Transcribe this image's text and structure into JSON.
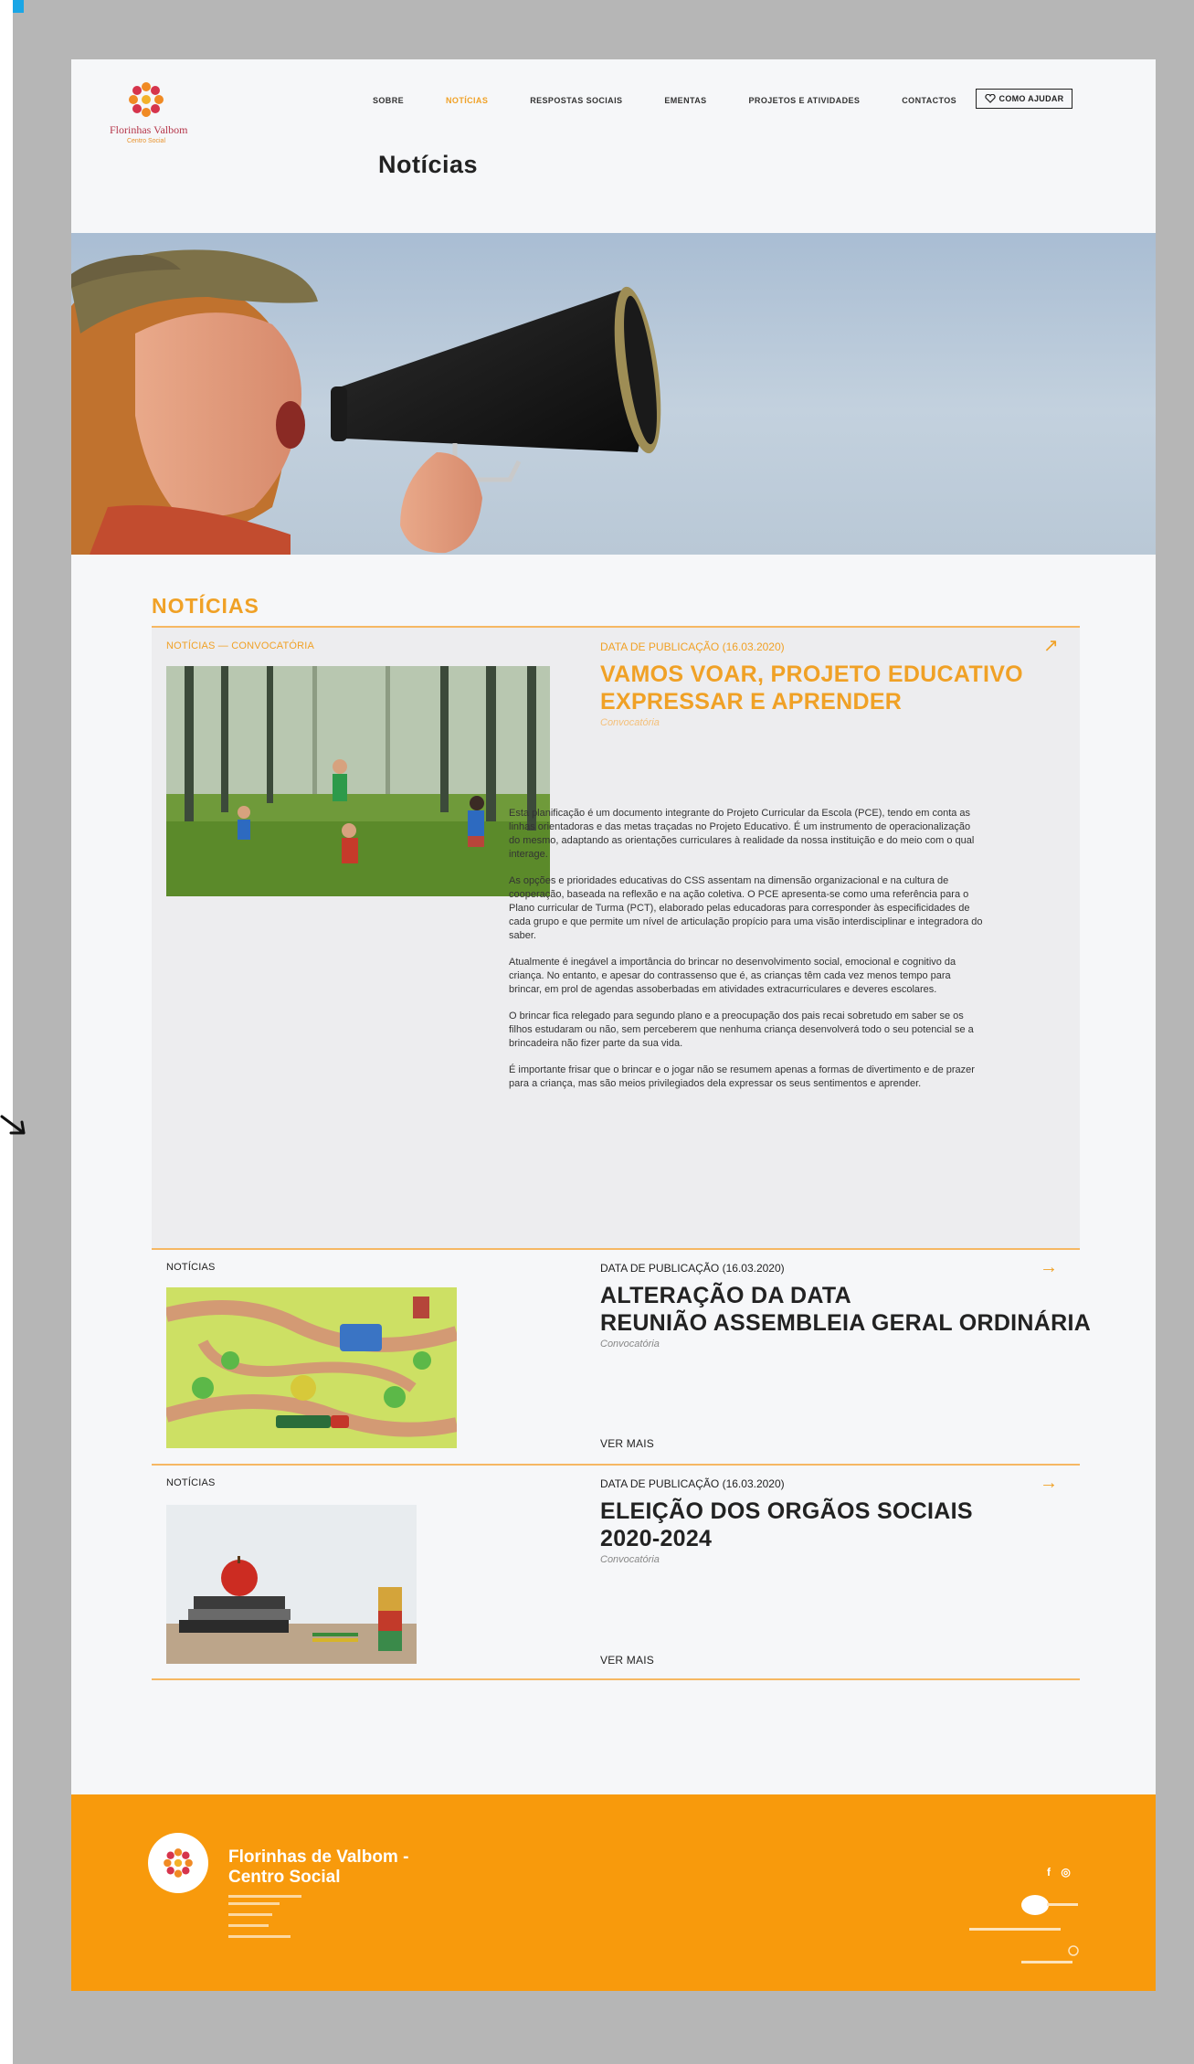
{
  "header": {
    "logo": {
      "name": "Florinhas Valbom",
      "subtitle": "Centro Social"
    },
    "nav": [
      {
        "label": "SOBRE",
        "active": false
      },
      {
        "label": "NOTÍCIAS",
        "active": true
      },
      {
        "label": "RESPOSTAS SOCIAIS",
        "active": false
      },
      {
        "label": "EMENTAS",
        "active": false
      },
      {
        "label": "PROJETOS E ATIVIDADES",
        "active": false
      },
      {
        "label": "CONTACTOS",
        "active": false
      }
    ],
    "help_button": "COMO AJUDAR",
    "page_title": "Notícias"
  },
  "news": {
    "section_title": "NOTÍCIAS",
    "featured": {
      "category": "NOTÍCIAS — CONVOCATÓRIA",
      "date": "DATA DE PUBLICAÇÃO (16.03.2020)",
      "title_line1": "VAMOS VOAR, PROJETO EDUCATIVO",
      "title_line2": "EXPRESSAR E APRENDER",
      "subcategory": "Convocatória",
      "paragraphs": [
        "Esta planificação é um documento integrante do Projeto Curricular da Escola (PCE), tendo em conta as linhas orientadoras e das metas traçadas no Projeto Educativo. É um instrumento de operacionalização do mesmo, adaptando as orientações curriculares à realidade da nossa instituição e do meio com o qual interage.",
        "As opções e prioridades educativas do CSS assentam na dimensão organizacional e na cultura de cooperação, baseada na reflexão e na ação coletiva. O PCE apresenta-se como uma referência para o Plano curricular de Turma (PCT), elaborado pelas educadoras para corresponder às especificidades de cada grupo e que permite um nível de articulação propício para uma visão interdisciplinar e integradora do saber.",
        "Atualmente é inegável a importância do brincar no desenvolvimento social, emocional e cognitivo da criança. No entanto, e apesar do contrassenso que é, as crianças têm cada vez menos tempo para brincar, em prol de agendas assoberbadas em atividades extracurriculares e deveres escolares.",
        "O brincar fica relegado para segundo plano e a preocupação dos pais recai sobretudo em saber se os filhos estudaram ou não, sem perceberem que nenhuma criança desenvolverá todo o seu potencial se a brincadeira não fizer parte da sua vida.",
        "É importante frisar que o brincar e o jogar não se resumem apenas a formas de divertimento e de prazer para a criança, mas são meios privilegiados dela expressar os seus sentimentos e aprender."
      ],
      "arrow": "↗"
    },
    "items": [
      {
        "category": "NOTÍCIAS",
        "date": "DATA DE PUBLICAÇÃO (16.03.2020)",
        "title_line1": "ALTERAÇÃO DA DATA",
        "title_line2": "REUNIÃO ASSEMBLEIA GERAL ORDINÁRIA",
        "subcategory": "Convocatória",
        "more": "VER MAIS",
        "arrow": "→"
      },
      {
        "category": "NOTÍCIAS",
        "date": "DATA DE PUBLICAÇÃO (16.03.2020)",
        "title_line1": "ELEIÇÃO DOS ORGÃOS SOCIAIS",
        "title_line2": "2020-2024",
        "subcategory": "Convocatória",
        "more": "VER MAIS",
        "arrow": "→"
      }
    ]
  },
  "footer": {
    "title_line1": "Florinhas de Valbom -",
    "title_line2": "Centro Social",
    "social": "f ◎"
  },
  "colors": {
    "accent": "#f0a126",
    "footer_bg": "#f89a0c",
    "page_bg": "#f6f7f9",
    "frame_bg": "#b6b6b6"
  },
  "icons": [
    "logo-flower-icon",
    "heart-icon",
    "arrow-up-right-icon",
    "arrow-right-icon",
    "facebook-icon",
    "instagram-icon"
  ]
}
